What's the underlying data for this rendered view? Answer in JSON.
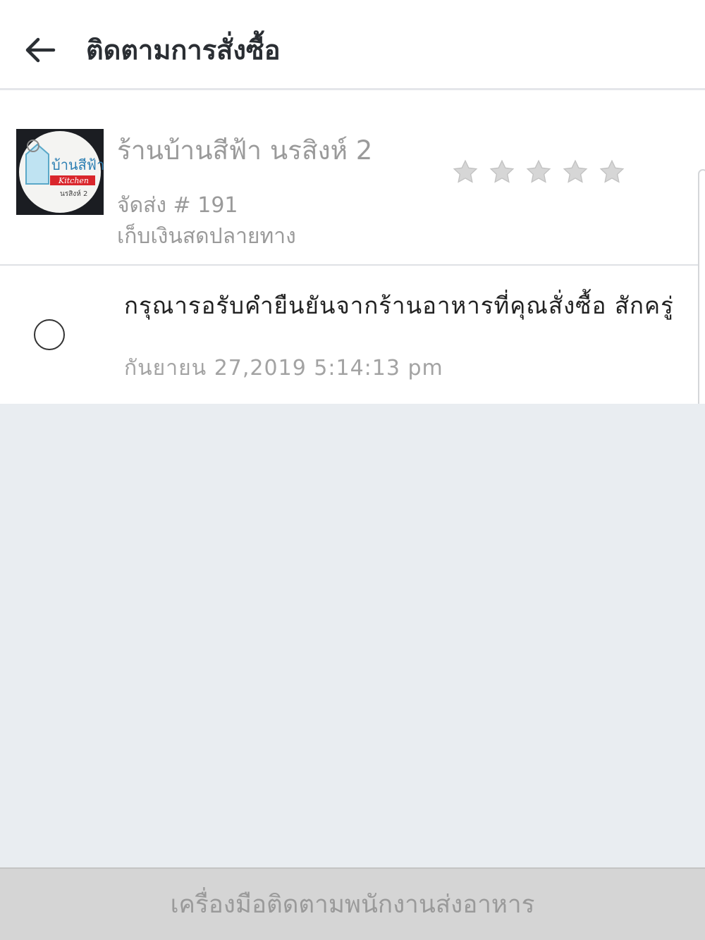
{
  "header": {
    "title": "ติดตามการสั่งซื้อ"
  },
  "order": {
    "store_name": "ร้านบ้านสีฟ้า นรสิงห์ 2",
    "logo_text": "บ้านสีฟ้า Kitchen นรสิงห์ 2",
    "delivery": "จัดส่ง # 191",
    "payment": "เก็บเงินสดปลายทาง",
    "rating_max": 5,
    "rating_value": 0
  },
  "status": {
    "message": "กรุณารอรับคำยืนยันจากร้านอาหารที่คุณสั่งซื้อ สักครู่",
    "timestamp": "กันยายน 27,2019 5:14:13 pm"
  },
  "footer": {
    "button_label": "เครื่องมือติดตามพนักงานส่งอาหาร"
  },
  "colors": {
    "star": "#d6d6d6",
    "background_gray": "#e9edf1",
    "footer_gray": "#d5d5d5"
  }
}
